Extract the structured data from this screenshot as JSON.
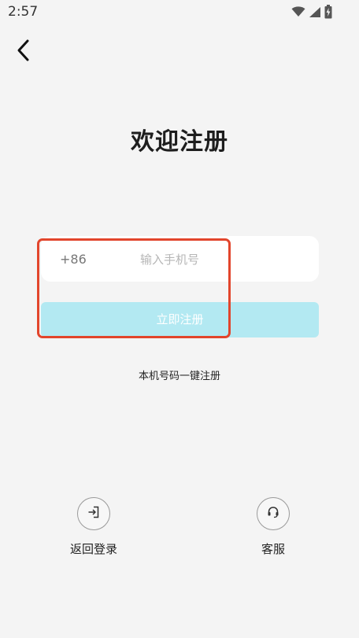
{
  "status_bar": {
    "time": "2:57",
    "icons": [
      "wifi-icon",
      "signal-icon",
      "battery-charging-icon"
    ]
  },
  "header": {
    "back_icon": "chevron-left-icon",
    "title": "欢迎注册"
  },
  "form": {
    "country_code": "+86",
    "phone_placeholder": "输入手机号",
    "phone_value": "",
    "register_label": "立即注册"
  },
  "links": {
    "one_click_register": "本机号码一键注册"
  },
  "bottom_actions": {
    "back_to_login": {
      "icon": "login-arrow-icon",
      "label": "返回登录"
    },
    "customer_service": {
      "icon": "headset-icon",
      "label": "客服"
    }
  },
  "colors": {
    "background": "#f4f4f4",
    "register_button": "#b3e9f2",
    "highlight_border": "#e2452c"
  }
}
